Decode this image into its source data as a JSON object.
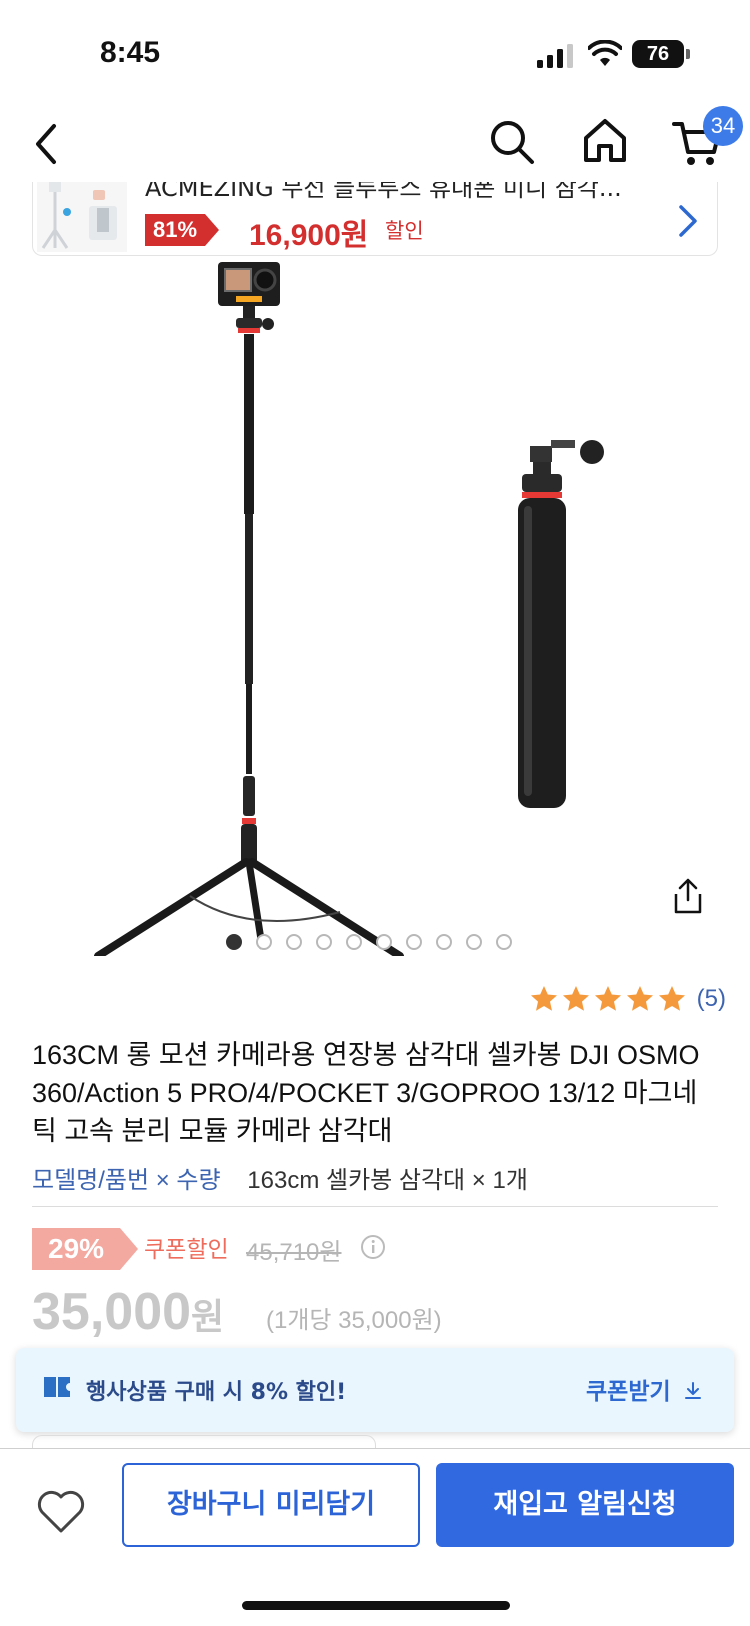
{
  "status_bar": {
    "time": "8:45",
    "battery": "76"
  },
  "nav": {
    "cart_count": "34"
  },
  "promo": {
    "title": "ACMEZING 무선 블루투스 휴대폰 미니 삼각...",
    "discount": "81%",
    "price": "16,900원",
    "label": "할인"
  },
  "gallery": {
    "image_count": 10,
    "active_index": 0
  },
  "rating": {
    "stars": 5,
    "count": "(5)"
  },
  "product": {
    "title": "163CM 롱 모션 카메라용 연장봉 삼각대 셀카봉 DJI OSMO 360/Action 5 PRO/4/POCKET 3/GOPROO 13/12 마그네틱 고속 분리 모듈 카메라 삼각대",
    "option_key": "모델명/품번 × 수량",
    "option_value": "163cm 셀카봉 삼각대 × 1개"
  },
  "pricing": {
    "discount": "29%",
    "coupon_label": "쿠폰할인",
    "original": "45,710원",
    "price": "35,000",
    "currency": "원",
    "unit_price": "(1개당 35,000원)"
  },
  "banner": {
    "text": "행사상품 구매 시 8% 할인!",
    "button": "쿠폰받기"
  },
  "bottom": {
    "cart_button": "장바구니 미리담기",
    "alert_button": "재입고 알림신청"
  },
  "colors": {
    "accent": "#3069e0",
    "sale_red": "#d32f2f",
    "star": "#f59a3c",
    "discount_badge": "#f3a8a0"
  }
}
